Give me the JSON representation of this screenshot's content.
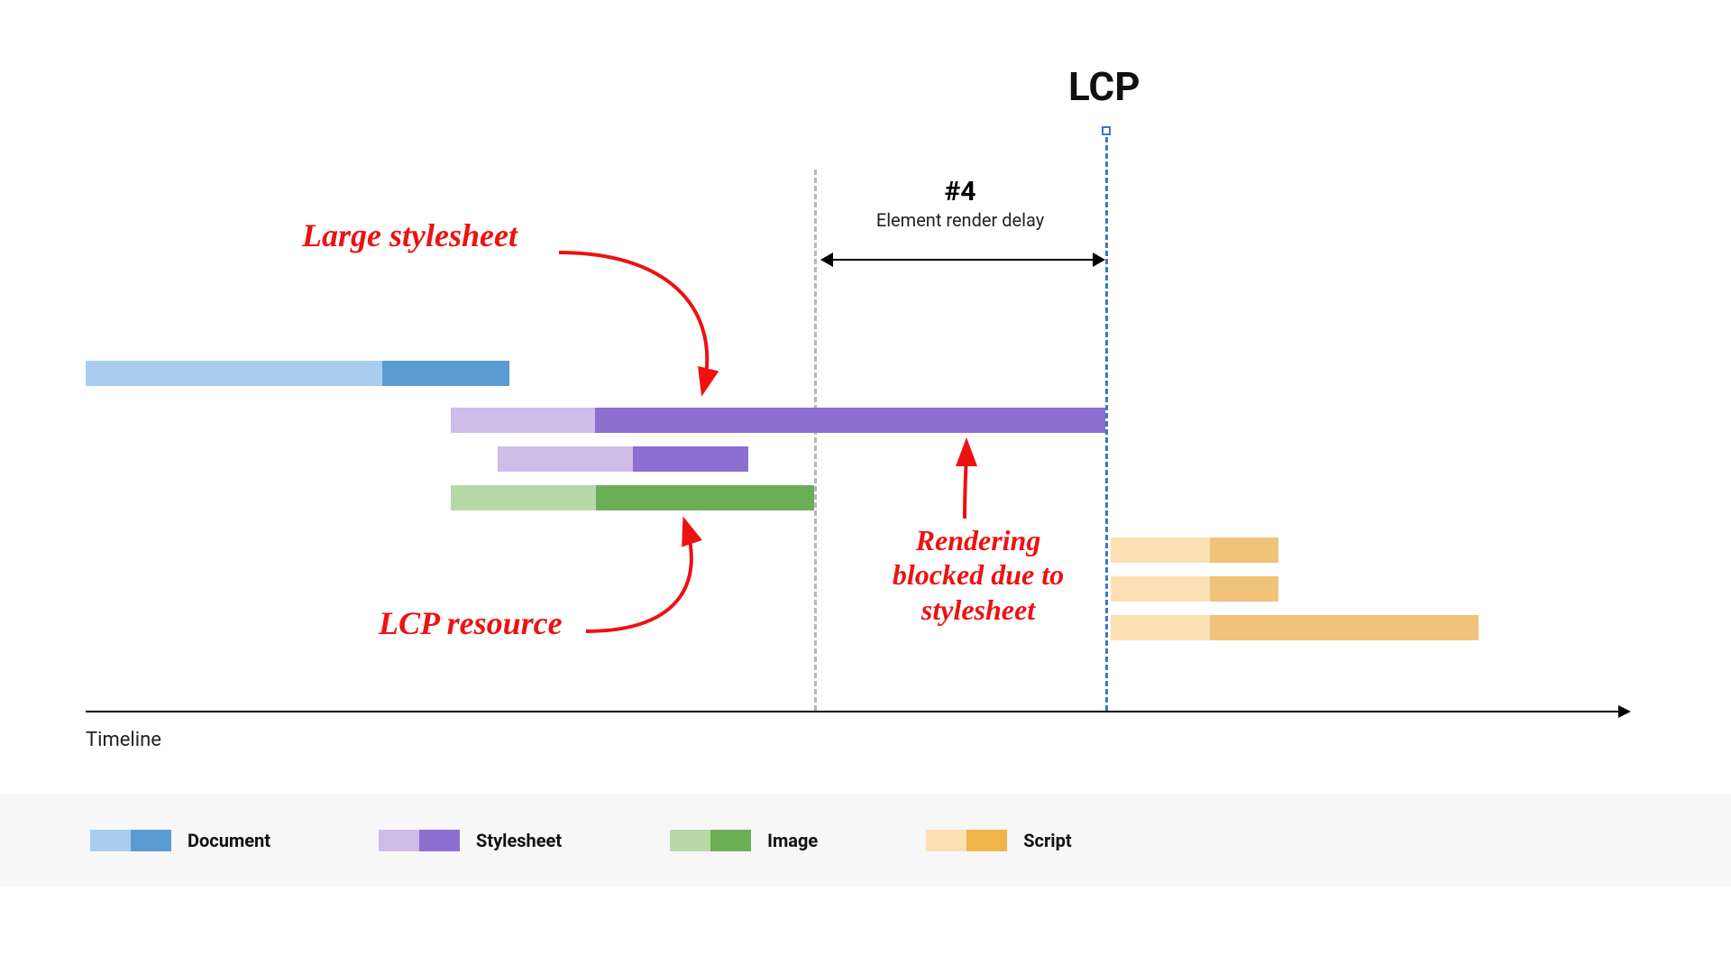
{
  "lcp_label": "LCP",
  "axis_label": "Timeline",
  "phase": {
    "num": "#4",
    "sub": "Element render delay"
  },
  "annotations": {
    "large_stylesheet": "Large stylesheet",
    "lcp_resource": "LCP resource",
    "rendering_blocked_l1": "Rendering",
    "rendering_blocked_l2": "blocked due to",
    "rendering_blocked_l3": "stylesheet"
  },
  "legend": [
    {
      "label": "Document",
      "light": "#a9cdef",
      "dark": "#5a9bd4"
    },
    {
      "label": "Stylesheet",
      "light": "#cfbce9",
      "dark": "#8c6fd1"
    },
    {
      "label": "Image",
      "light": "#b7d9a7",
      "dark": "#6bae56"
    },
    {
      "label": "Script",
      "light": "#fbe0b3",
      "dark": "#f0b44a"
    }
  ],
  "colors": {
    "doc_light": "#a9cdef",
    "doc_dark": "#5a9bd4",
    "sty_light": "#cfbce9",
    "sty_dark": "#8c6fd1",
    "img_light": "#b7d9a7",
    "img_dark": "#6bae56",
    "scr_light": "#fbe0b3",
    "scr_dark": "#f0b44a",
    "gray_dash": "#b8b8b8",
    "lcp_dash": "#3b78c2",
    "red": "#e11"
  },
  "chart_data": {
    "type": "gantt-diagram",
    "title": "LCP timeline waterfall showing element render delay caused by large render-blocking stylesheet",
    "xlabel": "Timeline",
    "x_range_percent": [
      0,
      100
    ],
    "markers": [
      {
        "name": "render-start",
        "x": 48.5,
        "style": "gray-dashed"
      },
      {
        "name": "LCP",
        "x": 68.0,
        "style": "blue-dashed"
      }
    ],
    "phase_span": {
      "label": "#4 Element render delay",
      "from": 48.5,
      "to": 68.0
    },
    "bars": [
      {
        "name": "Document",
        "type": "document",
        "row": 0,
        "start": 0.0,
        "split": 18.5,
        "end": 26.5
      },
      {
        "name": "Large stylesheet",
        "type": "stylesheet",
        "row": 1,
        "start": 23.0,
        "split": 33.0,
        "end": 68.0
      },
      {
        "name": "Stylesheet 2",
        "type": "stylesheet",
        "row": 2,
        "start": 26.0,
        "split": 35.5,
        "end": 43.5
      },
      {
        "name": "LCP image resource",
        "type": "image",
        "row": 3,
        "start": 23.0,
        "split": 33.0,
        "end": 48.5
      },
      {
        "name": "Script 1",
        "type": "script",
        "row": 4,
        "start": 68.5,
        "split": 75.3,
        "end": 80.0
      },
      {
        "name": "Script 2",
        "type": "script",
        "row": 5,
        "start": 68.5,
        "split": 75.3,
        "end": 80.0
      },
      {
        "name": "Script 3",
        "type": "script",
        "row": 6,
        "start": 68.5,
        "split": 75.3,
        "end": 93.5
      }
    ],
    "annotations": [
      {
        "text": "Large stylesheet",
        "points_to": "Large stylesheet"
      },
      {
        "text": "LCP resource",
        "points_to": "LCP image resource"
      },
      {
        "text": "Rendering blocked due to stylesheet",
        "points_to": "phase_span"
      }
    ]
  }
}
